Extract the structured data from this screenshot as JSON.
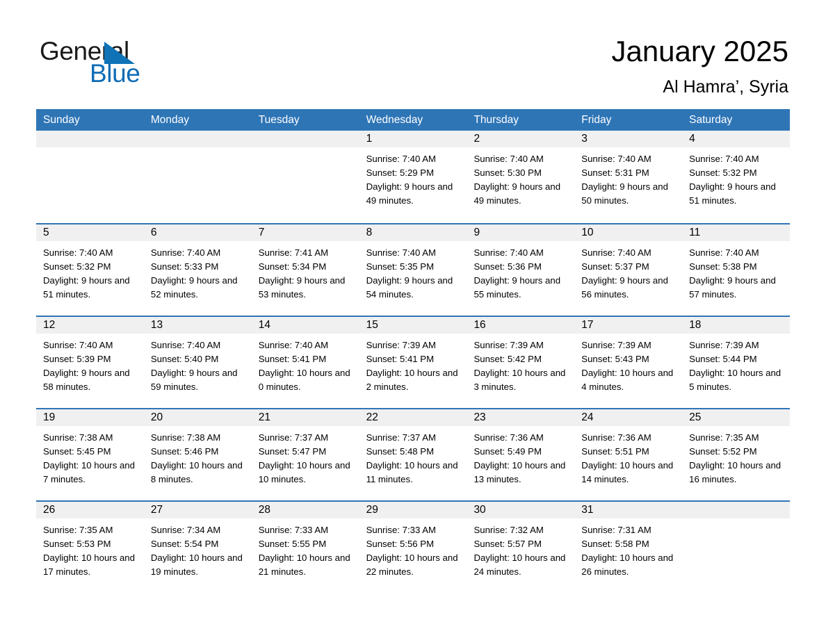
{
  "brand": {
    "word_one": "General",
    "word_two": "Blue",
    "triangle_color": "#1073b8",
    "blue_color": "#0f6cb5"
  },
  "header": {
    "title": "January 2025",
    "location": "Al Hamra’, Syria"
  },
  "theme": {
    "header_blue": "#2e75b6",
    "day_band_gray": "#f0f0f0",
    "text": "#000000"
  },
  "weekdays": [
    "Sunday",
    "Monday",
    "Tuesday",
    "Wednesday",
    "Thursday",
    "Friday",
    "Saturday"
  ],
  "weeks": [
    [
      {
        "empty": true
      },
      {
        "empty": true
      },
      {
        "empty": true
      },
      {
        "day": "1",
        "sunrise": "Sunrise: 7:40 AM",
        "sunset": "Sunset: 5:29 PM",
        "daylight": "Daylight: 9 hours and 49 minutes."
      },
      {
        "day": "2",
        "sunrise": "Sunrise: 7:40 AM",
        "sunset": "Sunset: 5:30 PM",
        "daylight": "Daylight: 9 hours and 49 minutes."
      },
      {
        "day": "3",
        "sunrise": "Sunrise: 7:40 AM",
        "sunset": "Sunset: 5:31 PM",
        "daylight": "Daylight: 9 hours and 50 minutes."
      },
      {
        "day": "4",
        "sunrise": "Sunrise: 7:40 AM",
        "sunset": "Sunset: 5:32 PM",
        "daylight": "Daylight: 9 hours and 51 minutes."
      }
    ],
    [
      {
        "day": "5",
        "sunrise": "Sunrise: 7:40 AM",
        "sunset": "Sunset: 5:32 PM",
        "daylight": "Daylight: 9 hours and 51 minutes."
      },
      {
        "day": "6",
        "sunrise": "Sunrise: 7:40 AM",
        "sunset": "Sunset: 5:33 PM",
        "daylight": "Daylight: 9 hours and 52 minutes."
      },
      {
        "day": "7",
        "sunrise": "Sunrise: 7:41 AM",
        "sunset": "Sunset: 5:34 PM",
        "daylight": "Daylight: 9 hours and 53 minutes."
      },
      {
        "day": "8",
        "sunrise": "Sunrise: 7:40 AM",
        "sunset": "Sunset: 5:35 PM",
        "daylight": "Daylight: 9 hours and 54 minutes."
      },
      {
        "day": "9",
        "sunrise": "Sunrise: 7:40 AM",
        "sunset": "Sunset: 5:36 PM",
        "daylight": "Daylight: 9 hours and 55 minutes."
      },
      {
        "day": "10",
        "sunrise": "Sunrise: 7:40 AM",
        "sunset": "Sunset: 5:37 PM",
        "daylight": "Daylight: 9 hours and 56 minutes."
      },
      {
        "day": "11",
        "sunrise": "Sunrise: 7:40 AM",
        "sunset": "Sunset: 5:38 PM",
        "daylight": "Daylight: 9 hours and 57 minutes."
      }
    ],
    [
      {
        "day": "12",
        "sunrise": "Sunrise: 7:40 AM",
        "sunset": "Sunset: 5:39 PM",
        "daylight": "Daylight: 9 hours and 58 minutes."
      },
      {
        "day": "13",
        "sunrise": "Sunrise: 7:40 AM",
        "sunset": "Sunset: 5:40 PM",
        "daylight": "Daylight: 9 hours and 59 minutes."
      },
      {
        "day": "14",
        "sunrise": "Sunrise: 7:40 AM",
        "sunset": "Sunset: 5:41 PM",
        "daylight": "Daylight: 10 hours and 0 minutes."
      },
      {
        "day": "15",
        "sunrise": "Sunrise: 7:39 AM",
        "sunset": "Sunset: 5:41 PM",
        "daylight": "Daylight: 10 hours and 2 minutes."
      },
      {
        "day": "16",
        "sunrise": "Sunrise: 7:39 AM",
        "sunset": "Sunset: 5:42 PM",
        "daylight": "Daylight: 10 hours and 3 minutes."
      },
      {
        "day": "17",
        "sunrise": "Sunrise: 7:39 AM",
        "sunset": "Sunset: 5:43 PM",
        "daylight": "Daylight: 10 hours and 4 minutes."
      },
      {
        "day": "18",
        "sunrise": "Sunrise: 7:39 AM",
        "sunset": "Sunset: 5:44 PM",
        "daylight": "Daylight: 10 hours and 5 minutes."
      }
    ],
    [
      {
        "day": "19",
        "sunrise": "Sunrise: 7:38 AM",
        "sunset": "Sunset: 5:45 PM",
        "daylight": "Daylight: 10 hours and 7 minutes."
      },
      {
        "day": "20",
        "sunrise": "Sunrise: 7:38 AM",
        "sunset": "Sunset: 5:46 PM",
        "daylight": "Daylight: 10 hours and 8 minutes."
      },
      {
        "day": "21",
        "sunrise": "Sunrise: 7:37 AM",
        "sunset": "Sunset: 5:47 PM",
        "daylight": "Daylight: 10 hours and 10 minutes."
      },
      {
        "day": "22",
        "sunrise": "Sunrise: 7:37 AM",
        "sunset": "Sunset: 5:48 PM",
        "daylight": "Daylight: 10 hours and 11 minutes."
      },
      {
        "day": "23",
        "sunrise": "Sunrise: 7:36 AM",
        "sunset": "Sunset: 5:49 PM",
        "daylight": "Daylight: 10 hours and 13 minutes."
      },
      {
        "day": "24",
        "sunrise": "Sunrise: 7:36 AM",
        "sunset": "Sunset: 5:51 PM",
        "daylight": "Daylight: 10 hours and 14 minutes."
      },
      {
        "day": "25",
        "sunrise": "Sunrise: 7:35 AM",
        "sunset": "Sunset: 5:52 PM",
        "daylight": "Daylight: 10 hours and 16 minutes."
      }
    ],
    [
      {
        "day": "26",
        "sunrise": "Sunrise: 7:35 AM",
        "sunset": "Sunset: 5:53 PM",
        "daylight": "Daylight: 10 hours and 17 minutes."
      },
      {
        "day": "27",
        "sunrise": "Sunrise: 7:34 AM",
        "sunset": "Sunset: 5:54 PM",
        "daylight": "Daylight: 10 hours and 19 minutes."
      },
      {
        "day": "28",
        "sunrise": "Sunrise: 7:33 AM",
        "sunset": "Sunset: 5:55 PM",
        "daylight": "Daylight: 10 hours and 21 minutes."
      },
      {
        "day": "29",
        "sunrise": "Sunrise: 7:33 AM",
        "sunset": "Sunset: 5:56 PM",
        "daylight": "Daylight: 10 hours and 22 minutes."
      },
      {
        "day": "30",
        "sunrise": "Sunrise: 7:32 AM",
        "sunset": "Sunset: 5:57 PM",
        "daylight": "Daylight: 10 hours and 24 minutes."
      },
      {
        "day": "31",
        "sunrise": "Sunrise: 7:31 AM",
        "sunset": "Sunset: 5:58 PM",
        "daylight": "Daylight: 10 hours and 26 minutes."
      },
      {
        "empty": true
      }
    ]
  ]
}
